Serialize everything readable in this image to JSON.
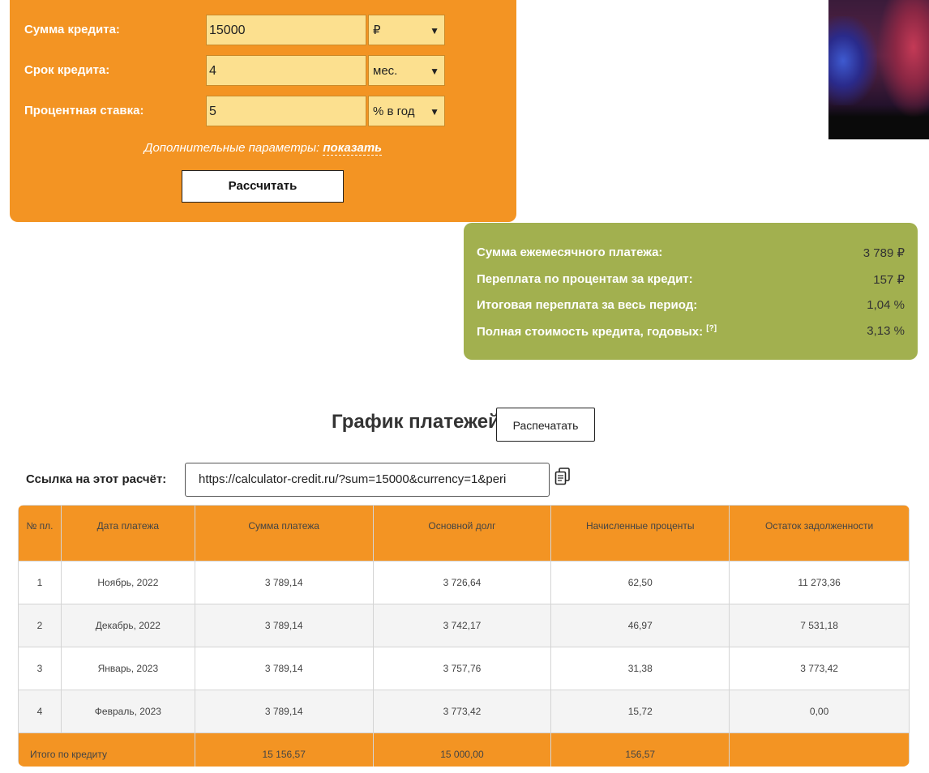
{
  "form": {
    "rows": [
      {
        "label": "Сумма кредита:",
        "value": "15000",
        "unit": "₽"
      },
      {
        "label": "Срок кредита:",
        "value": "4",
        "unit": "мес."
      },
      {
        "label": "Процентная ставка:",
        "value": "5",
        "unit": "% в год"
      }
    ],
    "extra_prefix": "Дополнительные параметры:",
    "extra_link": "показать",
    "calculate_label": "Рассчитать"
  },
  "results": {
    "rows": [
      {
        "label": "Сумма ежемесячного платежа:",
        "value": "3 789 ₽"
      },
      {
        "label": "Переплата по процентам за кредит:",
        "value": "157 ₽"
      },
      {
        "label": "Итоговая переплата за весь период:",
        "value": "1,04 %"
      },
      {
        "label": "Полная стоимость кредита, годовых:",
        "sup": "[?]",
        "value": "3,13 %"
      }
    ]
  },
  "schedule": {
    "title": "График платежей",
    "print_label": "Распечатать",
    "link_label": "Ссылка на этот расчёт:",
    "link_value": "https://calculator-credit.ru/?sum=15000&currency=1&peri",
    "columns": [
      "№ пл.",
      "Дата платежа",
      "Сумма платежа",
      "Основной долг",
      "Начисленные проценты",
      "Остаток задолженности"
    ],
    "rows": [
      [
        "1",
        "Ноябрь, 2022",
        "3 789,14",
        "3 726,64",
        "62,50",
        "11 273,36"
      ],
      [
        "2",
        "Декабрь, 2022",
        "3 789,14",
        "3 742,17",
        "46,97",
        "7 531,18"
      ],
      [
        "3",
        "Январь, 2023",
        "3 789,14",
        "3 757,76",
        "31,38",
        "3 773,42"
      ],
      [
        "4",
        "Февраль, 2023",
        "3 789,14",
        "3 773,42",
        "15,72",
        "0,00"
      ]
    ],
    "totals": {
      "label": "Итого по кредиту",
      "payment": "15 156,57",
      "principal": "15 000,00",
      "interest": "156,57"
    }
  },
  "icons": {
    "copy": "copy-icon",
    "select_arrow": "chevron-down-icon"
  },
  "colors": {
    "form_bg": "#f39423",
    "input_bg": "#fce08f",
    "result_bg": "#a2b04f",
    "table_head_bg": "#f39423"
  }
}
